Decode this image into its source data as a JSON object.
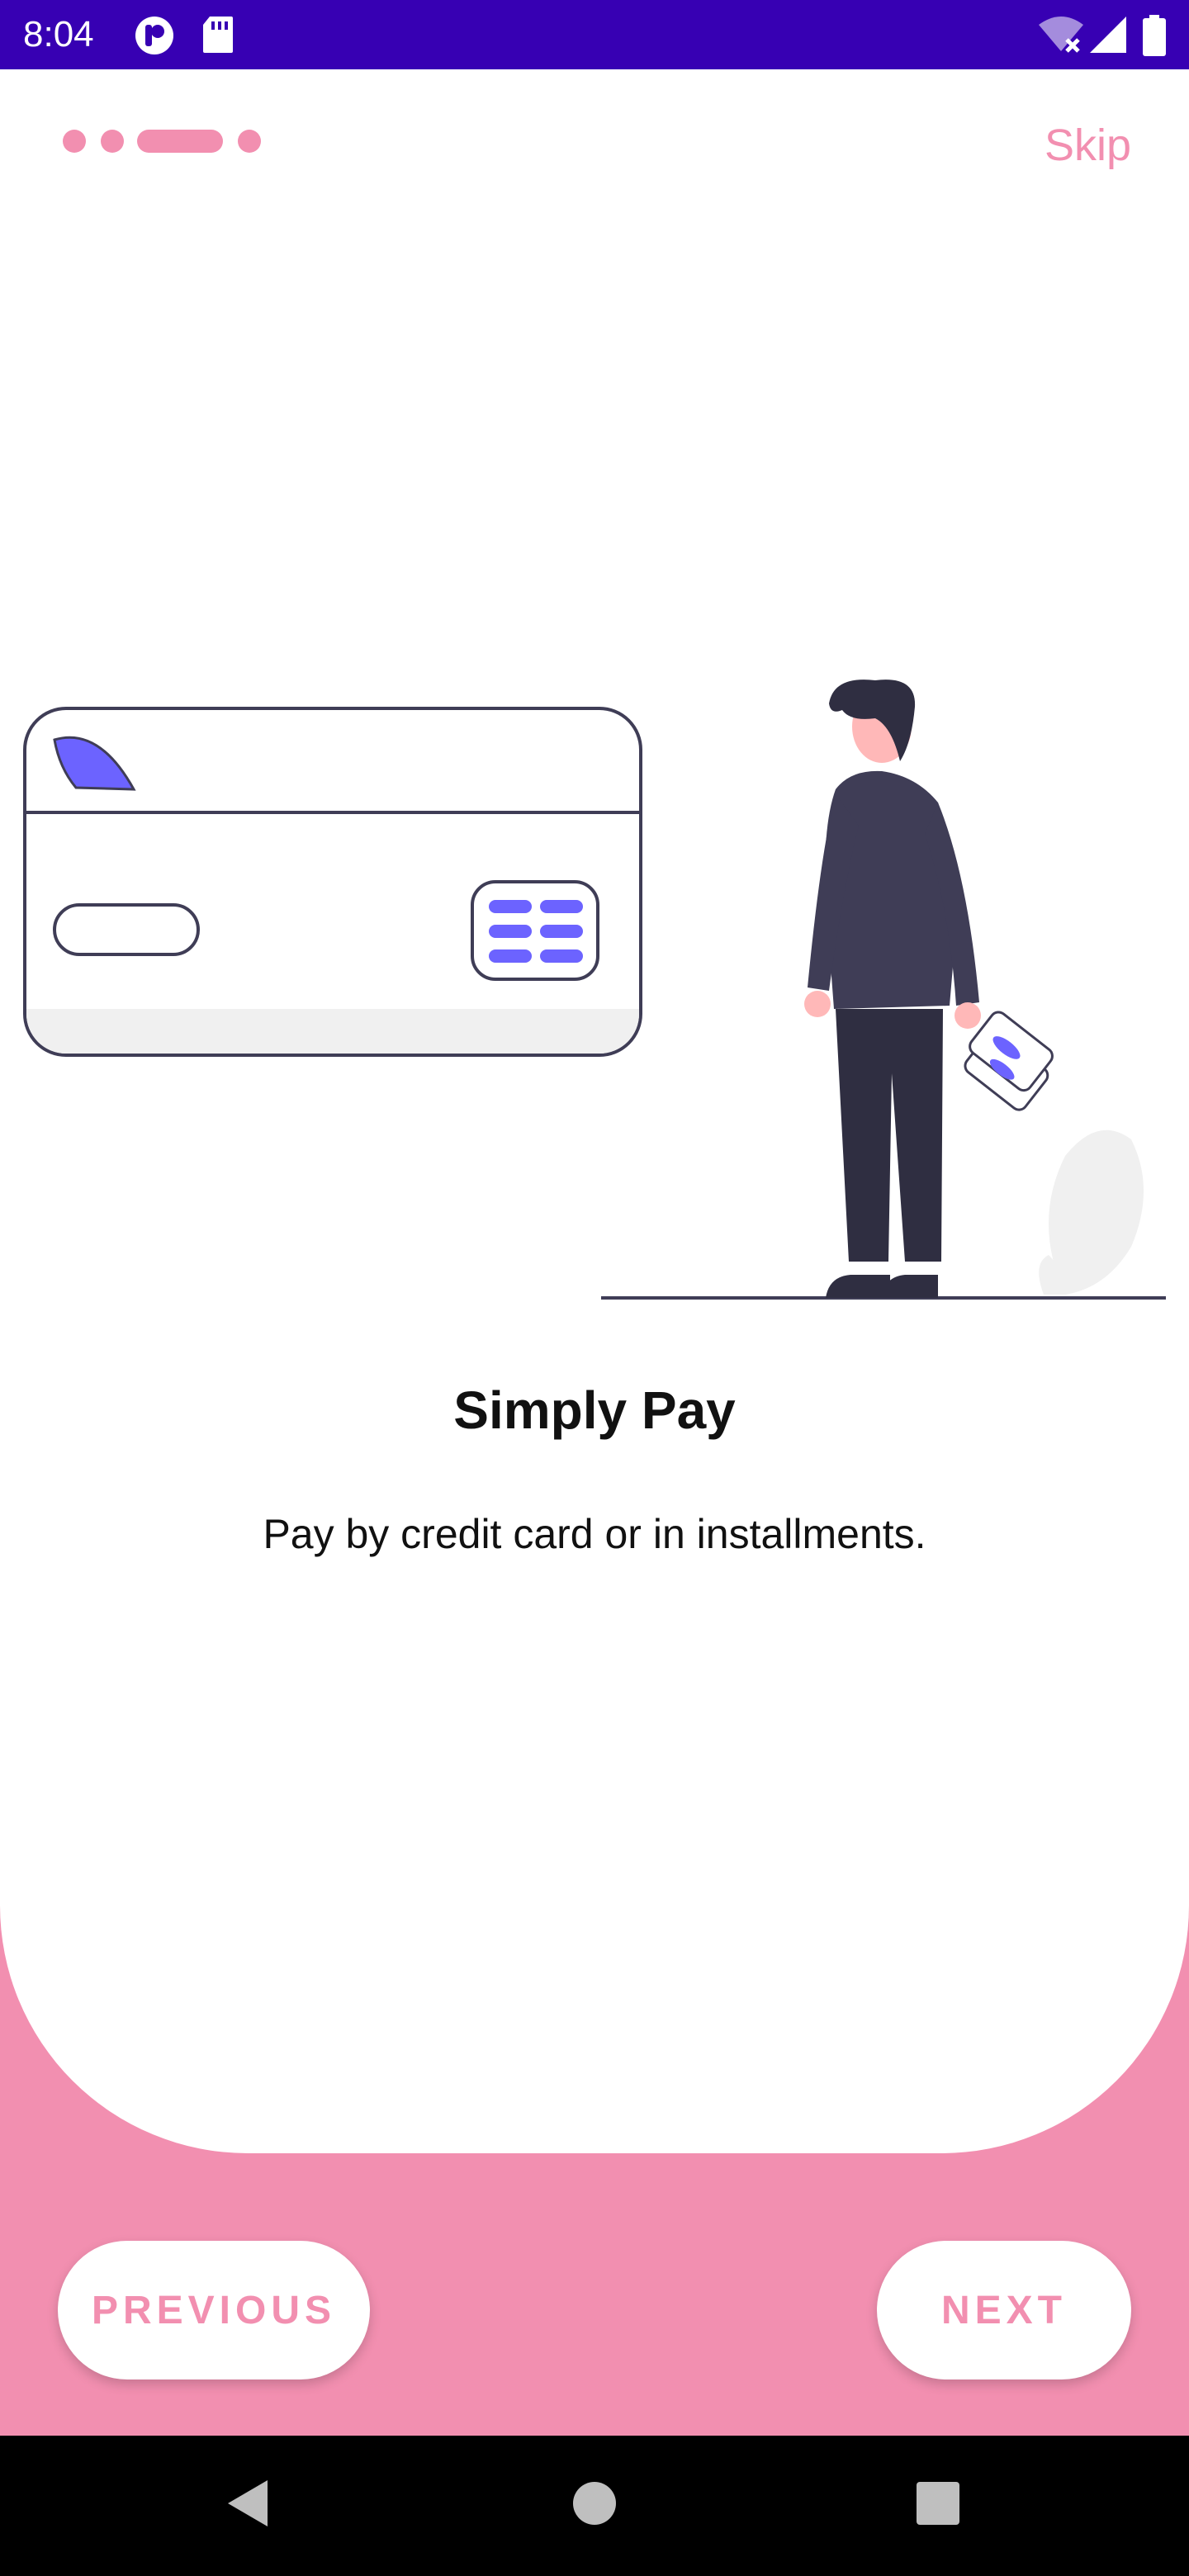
{
  "status_bar": {
    "time": "8:04",
    "icons": [
      "app-icon",
      "sd-card-icon",
      "wifi-icon",
      "signal-icon",
      "battery-icon"
    ]
  },
  "onboarding": {
    "page_indicator": {
      "total": 4,
      "active_index": 2
    },
    "skip_label": "Skip",
    "title": "Simply Pay",
    "subtitle": "Pay by credit card or in installments."
  },
  "buttons": {
    "previous_label": "PREVIOUS",
    "next_label": "NEXT"
  },
  "nav_bar": {
    "icons": [
      "back-icon",
      "home-icon",
      "recents-icon"
    ]
  },
  "colors": {
    "accent": "#f28fb0",
    "status_bar": "#3700b3",
    "illustration_accent": "#6c63ff",
    "illustration_dark": "#3f3d56"
  }
}
